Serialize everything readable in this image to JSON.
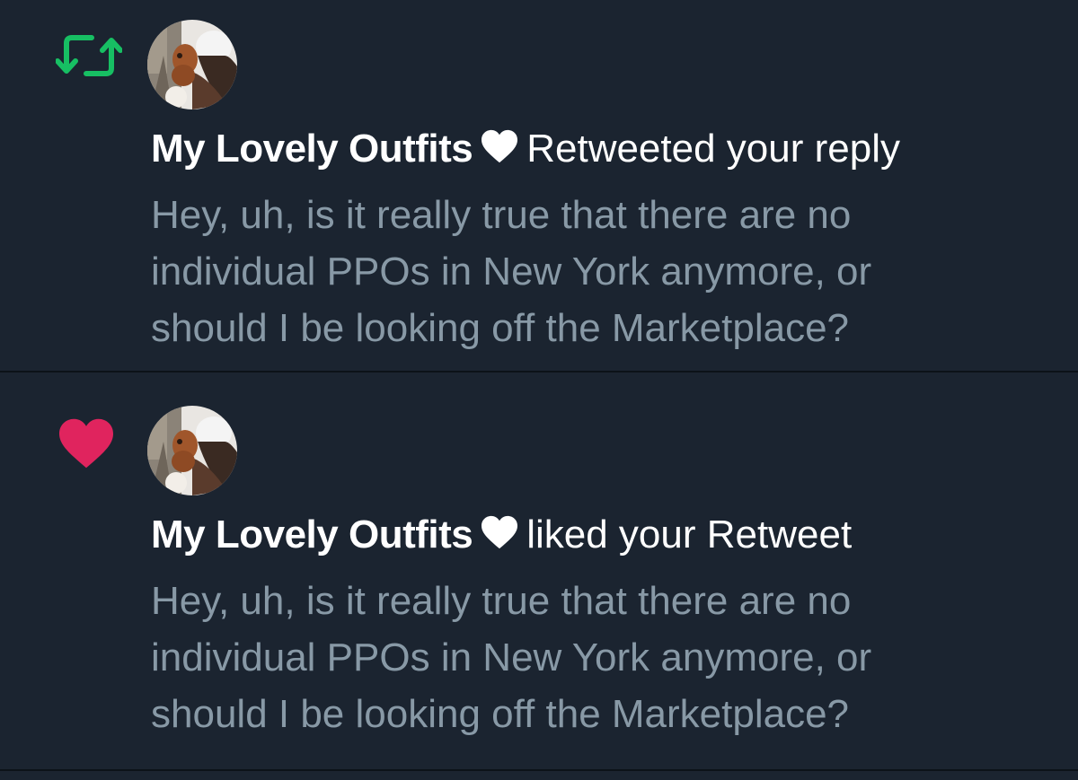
{
  "notifications": [
    {
      "type": "retweet",
      "icon": "retweet-icon",
      "icon_color": "#17bf63",
      "author": "My Lovely Outfits",
      "author_badge_icon": "white-heart-icon",
      "action": "Retweeted your reply",
      "tweet_lines": [
        "Hey, uh, is it really true that there are no",
        "individual PPOs in New York anymore, or",
        "should I be looking off the Marketplace?"
      ]
    },
    {
      "type": "like",
      "icon": "heart-icon",
      "icon_color": "#e0245e",
      "author": "My Lovely Outfits",
      "author_badge_icon": "white-heart-icon",
      "action": "liked your Retweet",
      "tweet_lines": [
        "Hey, uh, is it really true that there are no",
        "individual PPOs in New York anymore, or",
        "should I be looking off the Marketplace?"
      ]
    }
  ],
  "colors": {
    "background": "#1b2430",
    "primary_text": "#ffffff",
    "secondary_text": "#8899a6",
    "retweet_green": "#17bf63",
    "like_red": "#e0245e",
    "divider": "#0c1218"
  }
}
